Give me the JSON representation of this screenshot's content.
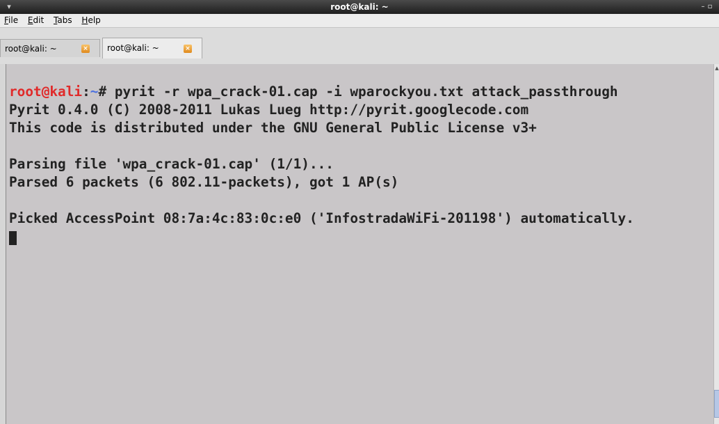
{
  "window": {
    "title": "root@kali: ~",
    "controls": [
      "–",
      "▫",
      "×"
    ]
  },
  "menu": {
    "items": [
      {
        "accel": "F",
        "rest": "ile"
      },
      {
        "accel": "E",
        "rest": "dit"
      },
      {
        "accel": "T",
        "rest": "abs"
      },
      {
        "accel": "H",
        "rest": "elp"
      }
    ]
  },
  "tabs": [
    {
      "label": "root@kali: ~",
      "active": false
    },
    {
      "label": "root@kali: ~",
      "active": true
    }
  ],
  "terminal": {
    "prompt": {
      "user_host": "root@kali",
      "separator": ":",
      "path": "~",
      "symbol": "# "
    },
    "command": "pyrit -r wpa_crack-01.cap -i wparockyou.txt attack_passthrough",
    "output": [
      "Pyrit 0.4.0 (C) 2008-2011 Lukas Lueg http://pyrit.googlecode.com",
      "This code is distributed under the GNU General Public License v3+",
      "",
      "Parsing file 'wpa_crack-01.cap' (1/1)...",
      "Parsed 6 packets (6 802.11-packets), got 1 AP(s)",
      "",
      "Picked AccessPoint 08:7a:4c:83:0c:e0 ('InfostradaWiFi-201198') automatically."
    ]
  },
  "colors": {
    "terminal_bg": "#c9c6c8",
    "text": "#222222",
    "prompt_user": "#e02a2a",
    "prompt_path": "#4a6fe0"
  }
}
